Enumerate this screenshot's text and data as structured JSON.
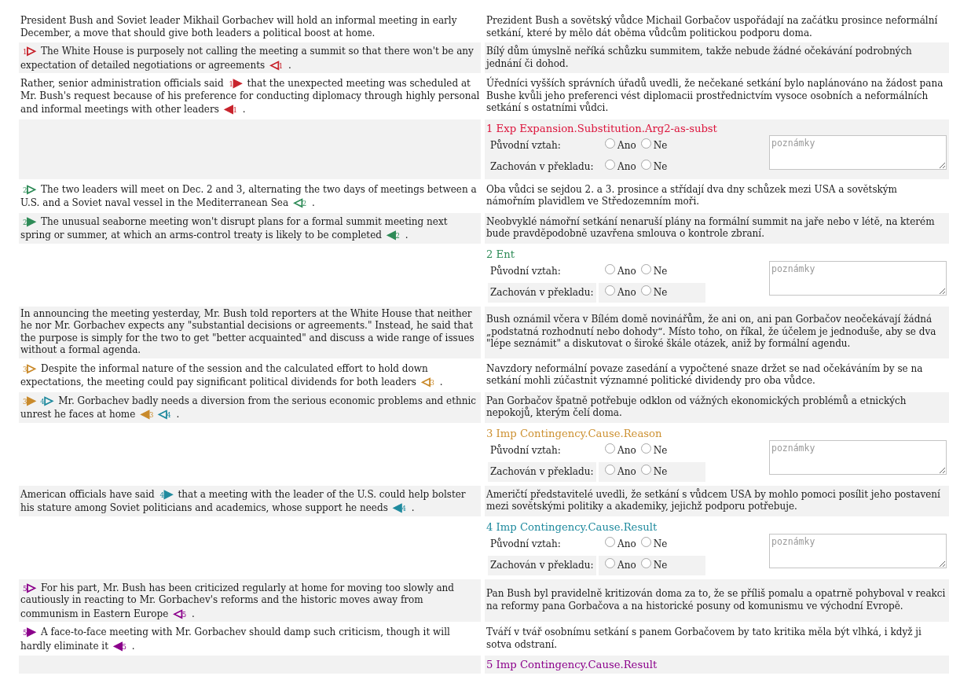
{
  "rows": [
    {
      "kind": "sentence",
      "source": [
        {
          "kind": "text",
          "text": "President Bush and Soviet leader Mikhail Gorbachev will hold an informal meeting in early December, a move that should give both leaders a political boost at home."
        }
      ],
      "target": "Prezident Bush a sovětský vůdce Michail Gorbačov uspořádají na začátku prosince neformální setkání, které by mělo dát oběma vůdcům politickou podporu doma."
    },
    {
      "kind": "sentence",
      "source": [
        {
          "kind": "open",
          "number": "1",
          "glyph": "▷",
          "color": "#c8232c"
        },
        {
          "kind": "text",
          "text": " The White House is purposely not calling the meeting a summit so that there won't be any expectation of detailed negotiations or agreements "
        },
        {
          "kind": "close",
          "number": "1",
          "glyph": "◁",
          "color": "#c8232c"
        },
        {
          "kind": "text",
          "text": " ."
        }
      ],
      "target": "Bílý dům úmyslně neříká schůzku summitem, takže nebude žádné očekávání podrobných jednání či dohod."
    },
    {
      "kind": "sentence",
      "source": [
        {
          "kind": "text",
          "text": "Rather, senior administration officials said "
        },
        {
          "kind": "open",
          "number": "1",
          "glyph": "▶",
          "color": "#c8232c"
        },
        {
          "kind": "text",
          "text": " that the unexpected meeting was scheduled at Mr. Bush's request because of his preference for conducting diplomacy through highly personal and informal meetings with other leaders "
        },
        {
          "kind": "close",
          "number": "1",
          "glyph": "◀",
          "color": "#c8232c"
        },
        {
          "kind": "text",
          "text": " ."
        }
      ],
      "target": "Úředníci vyšších správních úřadů uvedli, že nečekané setkání bylo naplánováno na žádost pana Bushe kvůli jeho preferenci vést diplomacii prostřednictvím vysoce osobních a neformálních setkání s ostatními vůdci."
    },
    {
      "kind": "relation",
      "title": "1 Exp Expansion.Substitution.Arg2-as-subst",
      "color": "#dc143c",
      "questions": [
        {
          "label": "Původní vztah:",
          "options": [
            {
              "label": "Ano",
              "selected": false
            },
            {
              "label": "Ne",
              "selected": false
            }
          ]
        },
        {
          "label": "Zachován v překladu:",
          "options": [
            {
              "label": "Ano",
              "selected": false
            },
            {
              "label": "Ne",
              "selected": false
            }
          ]
        }
      ],
      "notes": {
        "placeholder": "poznámky"
      }
    },
    {
      "kind": "sentence",
      "source": [
        {
          "kind": "open",
          "number": "2",
          "glyph": "▷",
          "color": "#2e8b57"
        },
        {
          "kind": "text",
          "text": " The two leaders will meet on Dec. 2 and 3, alternating the two days of meetings between a U.S. and a Soviet naval vessel in the Mediterranean Sea "
        },
        {
          "kind": "close",
          "number": "2",
          "glyph": "◁",
          "color": "#2e8b57"
        },
        {
          "kind": "text",
          "text": " ."
        }
      ],
      "target": "Oba vůdci se sejdou 2. a 3. prosince a střídají dva dny schůzek mezi USA a sovětským námořním plavidlem ve Středozemním moři."
    },
    {
      "kind": "sentence",
      "source": [
        {
          "kind": "open",
          "number": "2",
          "glyph": "▶",
          "color": "#2e8b57"
        },
        {
          "kind": "text",
          "text": " The unusual seaborne meeting won't disrupt plans for a formal summit meeting next spring or summer, at which an arms-control treaty is likely to be completed "
        },
        {
          "kind": "close",
          "number": "2",
          "glyph": "◀",
          "color": "#2e8b57"
        },
        {
          "kind": "text",
          "text": " ."
        }
      ],
      "target": "Neobvyklé námořní setkání nenaruší plány na formální summit na jaře nebo v létě, na kterém bude pravděpodobně uzavřena smlouva o kontrole zbraní."
    },
    {
      "kind": "relation",
      "title": "2 Ent",
      "color": "#2e8b57",
      "questions": [
        {
          "label": "Původní vztah:",
          "options": [
            {
              "label": "Ano",
              "selected": false
            },
            {
              "label": "Ne",
              "selected": false
            }
          ]
        },
        {
          "label": "Zachován v překladu:",
          "options": [
            {
              "label": "Ano",
              "selected": false
            },
            {
              "label": "Ne",
              "selected": false
            }
          ]
        }
      ],
      "notes": {
        "placeholder": "poznámky"
      }
    },
    {
      "kind": "sentence",
      "source": [
        {
          "kind": "text",
          "text": "In announcing the meeting yesterday, Mr. Bush told reporters at the White House that neither he nor Mr. Gorbachev expects any \"substantial decisions or agreements.\" Instead, he said that the purpose is simply for the two to get \"better acquainted\" and discuss a wide range of issues without a formal agenda."
        }
      ],
      "target": "Bush oznámil včera v Bílém domě novinářům, že ani on, ani pan Gorbačov neočekávají žádná „podstatná rozhodnutí nebo dohody“. Místo toho, on říkal, že účelem je jednoduše, aby se dva \"lépe seznámit\" a diskutovat o široké škále otázek, aniž by formální agendu."
    },
    {
      "kind": "sentence",
      "source": [
        {
          "kind": "open",
          "number": "3",
          "glyph": "▷",
          "color": "#c98a2b"
        },
        {
          "kind": "text",
          "text": " Despite the informal nature of the session and the calculated effort to hold down expectations, the meeting could pay significant political dividends for both leaders "
        },
        {
          "kind": "close",
          "number": "3",
          "glyph": "◁",
          "color": "#c98a2b"
        },
        {
          "kind": "text",
          "text": " ."
        }
      ],
      "target": "Navzdory neformální povaze zasedání a vypočtené snaze držet se nad očekáváním by se na setkání mohli zúčastnit významné politické dividendy pro oba vůdce."
    },
    {
      "kind": "sentence",
      "source": [
        {
          "kind": "open",
          "number": "3",
          "glyph": "▶",
          "color": "#c98a2b"
        },
        {
          "kind": "open",
          "number": "4",
          "glyph": "▷",
          "color": "#1f8a9e"
        },
        {
          "kind": "text",
          "text": " Mr. Gorbachev badly needs a diversion from the serious economic problems and ethnic unrest he faces at home "
        },
        {
          "kind": "close",
          "number": "3",
          "glyph": "◀",
          "color": "#c98a2b"
        },
        {
          "kind": "close",
          "number": "4",
          "glyph": "◁",
          "color": "#1f8a9e"
        },
        {
          "kind": "text",
          "text": " ."
        }
      ],
      "target": "Pan Gorbačov špatně potřebuje odklon od vážných ekonomických problémů a etnických nepokojů, kterým čelí doma."
    },
    {
      "kind": "relation",
      "title": "3 Imp Contingency.Cause.Reason",
      "color": "#cd9132",
      "questions": [
        {
          "label": "Původní vztah:",
          "options": [
            {
              "label": "Ano",
              "selected": false
            },
            {
              "label": "Ne",
              "selected": false
            }
          ]
        },
        {
          "label": "Zachován v překladu:",
          "options": [
            {
              "label": "Ano",
              "selected": false
            },
            {
              "label": "Ne",
              "selected": false
            }
          ]
        }
      ],
      "notes": {
        "placeholder": "poznámky"
      }
    },
    {
      "kind": "sentence",
      "source": [
        {
          "kind": "text",
          "text": "American officials have said "
        },
        {
          "kind": "open",
          "number": "4",
          "glyph": "▶",
          "color": "#1f8a9e"
        },
        {
          "kind": "text",
          "text": " that a meeting with the leader of the U.S. could help bolster his stature among Soviet politicians and academics, whose support he needs "
        },
        {
          "kind": "close",
          "number": "4",
          "glyph": "◀",
          "color": "#1f8a9e"
        },
        {
          "kind": "text",
          "text": " ."
        }
      ],
      "target": "Američtí představitelé uvedli, že setkání s vůdcem USA by mohlo pomoci posílit jeho postavení mezi sovětskými politiky a akademiky, jejichž podporu potřebuje."
    },
    {
      "kind": "relation",
      "title": "4 Imp Contingency.Cause.Result",
      "color": "#1f8a9e",
      "questions": [
        {
          "label": "Původní vztah:",
          "options": [
            {
              "label": "Ano",
              "selected": false
            },
            {
              "label": "Ne",
              "selected": false
            }
          ]
        },
        {
          "label": "Zachován v překladu:",
          "options": [
            {
              "label": "Ano",
              "selected": false
            },
            {
              "label": "Ne",
              "selected": false
            }
          ]
        }
      ],
      "notes": {
        "placeholder": "poznámky"
      }
    },
    {
      "kind": "sentence",
      "source": [
        {
          "kind": "open",
          "number": "5",
          "glyph": "▷",
          "color": "#8b008b"
        },
        {
          "kind": "text",
          "text": " For his part, Mr. Bush has been criticized regularly at home for moving too slowly and cautiously in reacting to Mr. Gorbachev's reforms and the historic moves away from communism in Eastern Europe "
        },
        {
          "kind": "close",
          "number": "5",
          "glyph": "◁",
          "color": "#8b008b"
        },
        {
          "kind": "text",
          "text": " ."
        }
      ],
      "target": "Pan Bush byl pravidelně kritizován doma za to, že se příliš pomalu a opatrně pohyboval v reakci na reformy pana Gorbačova a na historické posuny od komunismu ve východní Evropě."
    },
    {
      "kind": "sentence",
      "source": [
        {
          "kind": "open",
          "number": "5",
          "glyph": "▶",
          "color": "#8b008b"
        },
        {
          "kind": "text",
          "text": " A face-to-face meeting with Mr. Gorbachev should damp such criticism, though it will hardly eliminate it "
        },
        {
          "kind": "close",
          "number": "5",
          "glyph": "◀",
          "color": "#8b008b"
        },
        {
          "kind": "text",
          "text": " ."
        }
      ],
      "target": "Tváří v tvář osobnímu setkání s panem Gorbačovem by tato kritika měla být vlhká, i když ji sotva odstraní."
    },
    {
      "kind": "relation",
      "title": "5 Imp Contingency.Cause.Result",
      "color": "#8b008b"
    }
  ]
}
